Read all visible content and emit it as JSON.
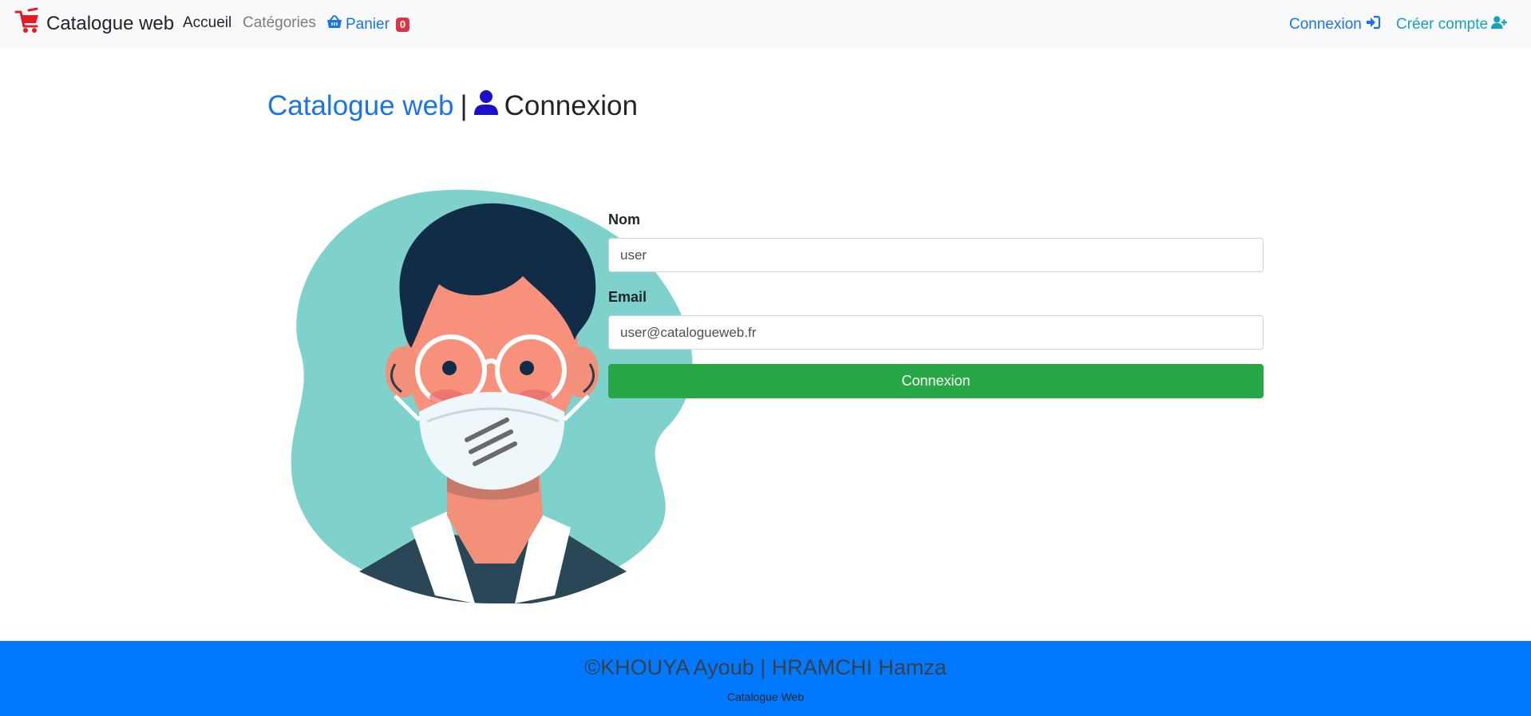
{
  "navbar": {
    "brand": "Catalogue web",
    "links": {
      "home": "Accueil",
      "categories": "Catégories",
      "cart": "Panier",
      "cart_count": "0",
      "login": "Connexion",
      "register": "Créer compte"
    }
  },
  "page": {
    "title_brand": "Catalogue web",
    "title_separator": "|",
    "title_text": "Connexion"
  },
  "form": {
    "name_label": "Nom",
    "name_value": "user",
    "email_label": "Email",
    "email_value": "user@catalogueweb.fr",
    "submit_label": "Connexion"
  },
  "footer": {
    "credits": "©KHOUYA Ayoub | HRAMCHI Hamza",
    "subtitle": "Catalogue Web"
  },
  "colors": {
    "primary": "#1a73e8",
    "success": "#28a745",
    "danger": "#dc3545",
    "info": "#17a2b8",
    "footer_bg": "#0079ff"
  },
  "icons": {
    "brand": "shopping-cart-icon",
    "cart": "basket-icon",
    "login": "sign-in-icon",
    "register": "user-plus-icon",
    "title": "user-icon"
  }
}
